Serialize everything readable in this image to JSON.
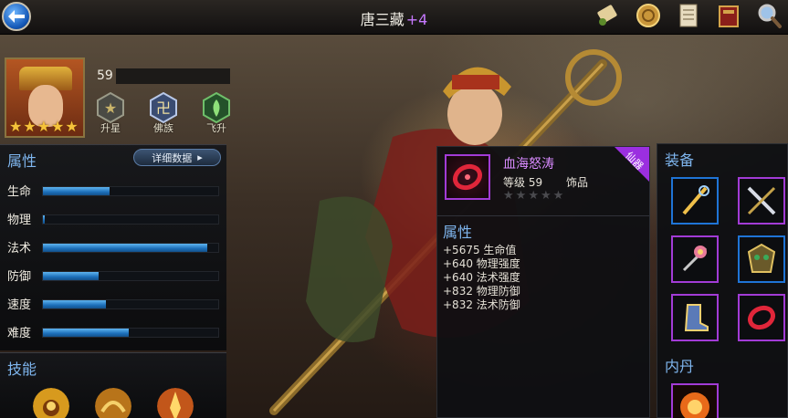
{
  "header": {
    "hero_name": "唐三藏",
    "hero_plus": "+4",
    "icons": [
      "scroll-icon",
      "coin-icon",
      "document-icon",
      "book-icon",
      "magnifier-icon"
    ]
  },
  "hero": {
    "level": "59",
    "stars": 5,
    "ranks": [
      {
        "icon": "star-rank-icon",
        "label": "升星"
      },
      {
        "icon": "buddhist-clan-icon",
        "label": "佛族"
      },
      {
        "icon": "ascend-icon",
        "label": "飞升"
      }
    ]
  },
  "attributes": {
    "title": "属性",
    "detail_button": "详细数据",
    "stats": [
      {
        "label": "生命",
        "fill": 0.38
      },
      {
        "label": "物理",
        "fill": 0.01
      },
      {
        "label": "法术",
        "fill": 0.94
      },
      {
        "label": "防御",
        "fill": 0.32
      },
      {
        "label": "速度",
        "fill": 0.36
      },
      {
        "label": "难度",
        "fill": 0.49
      }
    ]
  },
  "skills": {
    "title": "技能",
    "items": [
      "skill-1-icon",
      "skill-2-icon",
      "skill-3-icon"
    ]
  },
  "item_detail": {
    "name": "血海怒涛",
    "level": "等级 59",
    "type": "饰品",
    "rarity": "仙器",
    "stars": 5,
    "attr_title": "属性",
    "attrs": [
      "+5675 生命值",
      "+640 物理强度",
      "+640 法术强度",
      "+832 物理防御",
      "+832 法术防御"
    ]
  },
  "equipment": {
    "title": "装备",
    "neidan_title": "内丹",
    "slots": [
      {
        "icon": "golden-staff-icon",
        "rarity": "blue"
      },
      {
        "icon": "blades-icon",
        "rarity": "purple"
      },
      {
        "icon": "flower-cross-icon",
        "rarity": "purple"
      },
      {
        "icon": "demon-armor-icon",
        "rarity": "blue"
      },
      {
        "icon": "boots-icon",
        "rarity": "purple"
      },
      {
        "icon": "red-ring-icon",
        "rarity": "purple"
      }
    ]
  },
  "colors": {
    "accent_blue": "#7fb6ef",
    "rarity_purple": "#a23bd6",
    "rarity_blue": "#1f74d6",
    "item_name": "#d98bff",
    "star_gold": "#f5c23a"
  }
}
